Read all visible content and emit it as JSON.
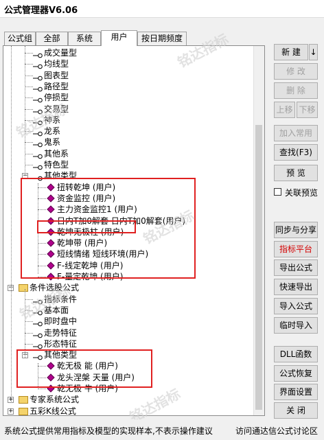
{
  "window": {
    "title": "公式管理器V6.06"
  },
  "tabs": [
    {
      "label": "公式组",
      "active": false
    },
    {
      "label": "全部",
      "active": false
    },
    {
      "label": "系统",
      "active": false
    },
    {
      "label": "用户",
      "active": true
    },
    {
      "label": "按日期频度",
      "active": false
    }
  ],
  "tree": {
    "items": [
      {
        "label": "成交量型",
        "kind": "key"
      },
      {
        "label": "均线型",
        "kind": "key"
      },
      {
        "label": "图表型",
        "kind": "key"
      },
      {
        "label": "路径型",
        "kind": "key"
      },
      {
        "label": "停损型",
        "kind": "key"
      },
      {
        "label": "交易型",
        "kind": "key"
      },
      {
        "label": "神系",
        "kind": "key"
      },
      {
        "label": "龙系",
        "kind": "key"
      },
      {
        "label": "鬼系",
        "kind": "key"
      },
      {
        "label": "其他系",
        "kind": "key"
      },
      {
        "label": "特色型",
        "kind": "key"
      },
      {
        "label": "其他类型",
        "kind": "key-expanded"
      },
      {
        "label": "扭转乾坤  (用户)",
        "kind": "diamond"
      },
      {
        "label": "资金监控  (用户)",
        "kind": "diamond"
      },
      {
        "label": "主力资金监控1  (用户)",
        "kind": "diamond"
      },
      {
        "label": "日内T加0解套  日内T加0解套(用户)",
        "kind": "diamond"
      },
      {
        "label": "乾坤无极柱  (用户)",
        "kind": "diamond"
      },
      {
        "label": "乾坤带  (用户)",
        "kind": "diamond"
      },
      {
        "label": "短线情绪  短线环境(用户)",
        "kind": "diamond"
      },
      {
        "label": "F-线定乾坤  (用户)",
        "kind": "diamond"
      },
      {
        "label": "F-量定乾坤  (用户)",
        "kind": "diamond"
      },
      {
        "label": "条件选股公式",
        "kind": "folder"
      },
      {
        "label": "指标条件",
        "kind": "key"
      },
      {
        "label": "基本面",
        "kind": "key"
      },
      {
        "label": "即时盘中",
        "kind": "key"
      },
      {
        "label": "走势特征",
        "kind": "key"
      },
      {
        "label": "形态特征",
        "kind": "key"
      },
      {
        "label": "其他类型",
        "kind": "key-expanded"
      },
      {
        "label": "乾无极 能  (用户)",
        "kind": "diamond"
      },
      {
        "label": "龙头涅槃 天量  (用户)",
        "kind": "diamond"
      },
      {
        "label": "乾无极 牛  (用户)",
        "kind": "diamond"
      },
      {
        "label": "专家系统公式",
        "kind": "folder"
      },
      {
        "label": "五彩K线公式",
        "kind": "folder"
      }
    ]
  },
  "buttons": {
    "new": "新  建",
    "new_arrow": "↓",
    "modify": "修  改",
    "delete": "删  除",
    "move_up": "上移",
    "move_down": "下移",
    "add_common": "加入常用",
    "find": "查找(F3)",
    "preview": "预  览",
    "linked_preview": "关联预览",
    "sync_share": "同步与分享",
    "indicator_platform": "指标平台",
    "export": "导出公式",
    "quick_export": "快速导出",
    "import": "导入公式",
    "temp_import": "临时导入",
    "dll": "DLL函数",
    "restore": "公式恢复",
    "ui_settings": "界面设置",
    "close": "关  闭"
  },
  "status": {
    "left": "系统公式提供常用指标及模型的实现样本,不表示操作建议",
    "right": "访问通达信公式讨论区"
  },
  "watermark": "铭达指标",
  "colors": {
    "highlight_box": "#e02020",
    "diamond": "#b0008c",
    "folder": "#f4d36b",
    "red_text": "#d40000"
  }
}
